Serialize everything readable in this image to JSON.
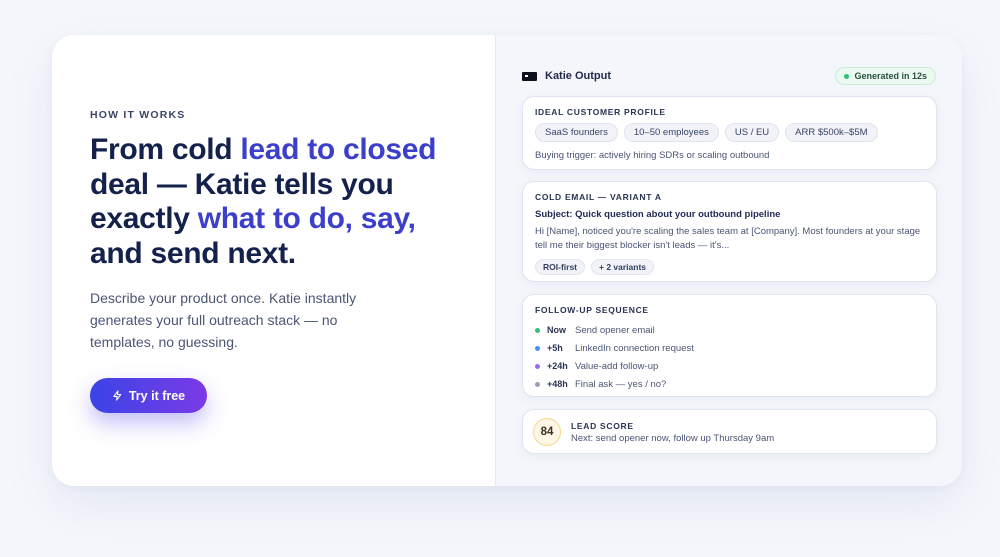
{
  "hero": {
    "eyebrow": "HOW IT WORKS",
    "headline_part1": "From cold ",
    "headline_accent1": "lead to closed",
    "headline_part2": " deal — Katie tells you exactly ",
    "headline_accent2": "what to do, say,",
    "headline_part3": " and send next.",
    "subtext": "Describe your product once. Katie instantly generates your full outreach stack — no templates, no guessing.",
    "cta_label": "Try it free",
    "cta_icon": "lightning-icon"
  },
  "output": {
    "title": "Katie Output",
    "title_icon": "terminal-icon",
    "badge": "Generated in 12s",
    "badge_color": "#2fc278",
    "icp": {
      "label": "IDEAL CUSTOMER PROFILE",
      "chips": [
        "SaaS founders",
        "10–50 employees",
        "US / EU",
        "ARR $500k–$5M"
      ],
      "trigger": "Buying trigger: actively hiring SDRs or scaling outbound"
    },
    "email": {
      "label": "COLD EMAIL — VARIANT A",
      "subject": "Subject: Quick question about your outbound pipeline",
      "body": "Hi [Name], noticed you're scaling the sales team at [Company]. Most founders at your stage tell me their biggest blocker isn't leads — it's...",
      "tags": [
        "ROI-first",
        "+ 2 variants"
      ]
    },
    "followup": {
      "label": "FOLLOW-UP SEQUENCE",
      "steps": [
        {
          "time": "Now",
          "text": "Send opener email",
          "color": "#2fc278"
        },
        {
          "time": "+5h",
          "text": "LinkedIn connection request",
          "color": "#4d8cf0"
        },
        {
          "time": "+24h",
          "text": "Value-add follow-up",
          "color": "#9b6cf0"
        },
        {
          "time": "+48h",
          "text": "Final ask — yes / no?",
          "color": "#9aa0b8"
        }
      ]
    },
    "lead": {
      "label": "LEAD SCORE",
      "score": "84",
      "next": "Next: send opener now, follow up Thursday 9am"
    }
  }
}
